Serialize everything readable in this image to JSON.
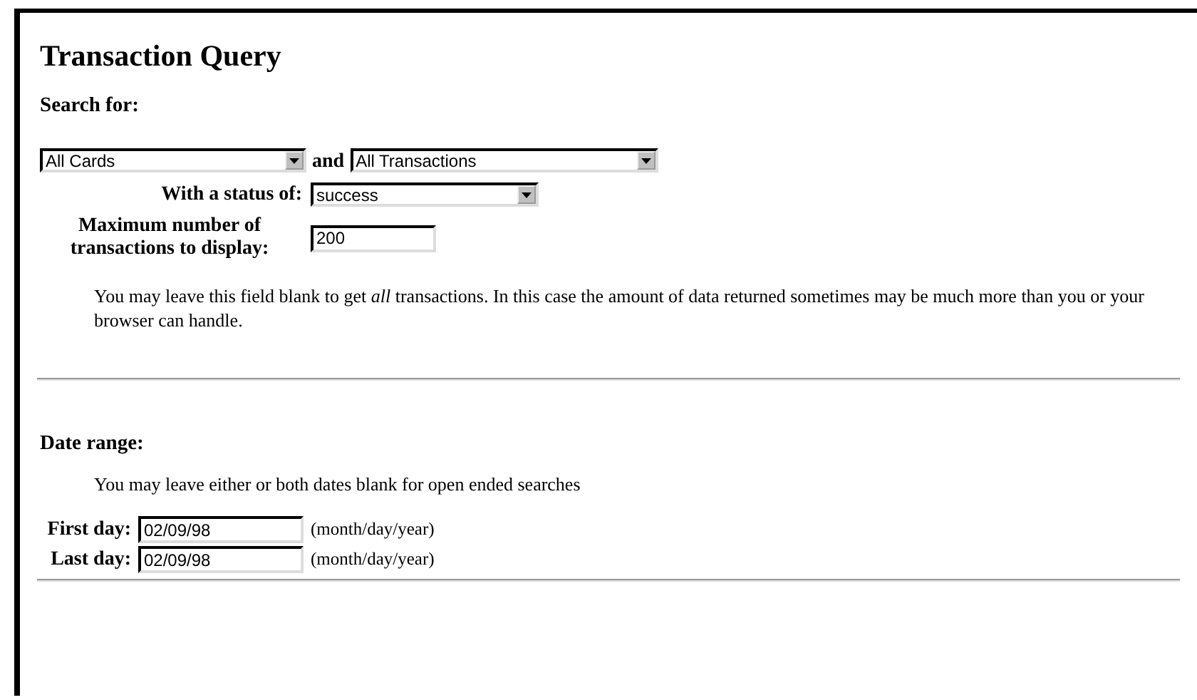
{
  "title": "Transaction Query",
  "search": {
    "heading": "Search for:",
    "card_select": "All Cards",
    "joiner": "and",
    "type_select": "All Transactions",
    "status_label": "With a status of:",
    "status_select": "success",
    "max_label": "Maximum number of transactions to display:",
    "max_value": "200",
    "note": "You may leave this field blank to get *all* transactions. In this case the amount of data returned sometimes may be much more than you or your browser can handle."
  },
  "date_range": {
    "heading": "Date range:",
    "note": "You may leave either or both dates blank for open ended searches",
    "fields": [
      {
        "label": "First day:",
        "value": "02/09/98",
        "hint": "(month/day/year)"
      },
      {
        "label": "Last day:",
        "value": "02/09/98",
        "hint": "(month/day/year)"
      }
    ]
  }
}
